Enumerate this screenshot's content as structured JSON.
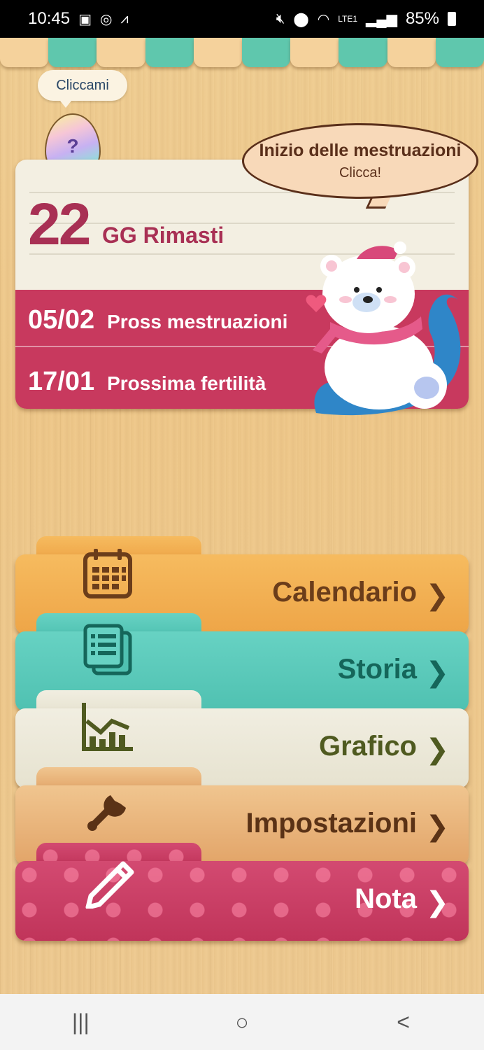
{
  "status_bar": {
    "time": "10:45",
    "battery": "85%",
    "icons_left": [
      "image-icon",
      "whatsapp-icon",
      "adidas-icon"
    ],
    "icons_right": [
      "mute-icon",
      "location-icon",
      "wifi-icon",
      "volte-icon",
      "signal-icon",
      "battery-icon"
    ]
  },
  "egg": {
    "hint": "Cliccami",
    "symbol": "?"
  },
  "period_card": {
    "days_left": "22",
    "days_label": "GG Rimasti",
    "bubble_title": "Inizio delle mestruazioni",
    "bubble_sub": "Clicca!",
    "rows": [
      {
        "date": "05/02",
        "label": "Pross mestruazioni"
      },
      {
        "date": "17/01",
        "label": "Prossima fertilità"
      }
    ]
  },
  "menu": {
    "calendar": {
      "label": "Calendario",
      "chevron": "❯"
    },
    "history": {
      "label": "Storia",
      "chevron": "❯"
    },
    "chart": {
      "label": "Grafico",
      "chevron": "❯"
    },
    "settings": {
      "label": "Impostazioni",
      "chevron": "❯"
    },
    "note": {
      "label": "Nota",
      "chevron": "❯"
    }
  },
  "nav": {
    "recent": "|||",
    "home": "○",
    "back": "<"
  },
  "colors": {
    "accent_red": "#c8395e",
    "calendar_tab": "#f6bb5f",
    "history_tab": "#67d2c3",
    "chart_tab": "#f1eee1",
    "settings_tab": "#f0c58f",
    "note_tab": "#d34a71"
  }
}
